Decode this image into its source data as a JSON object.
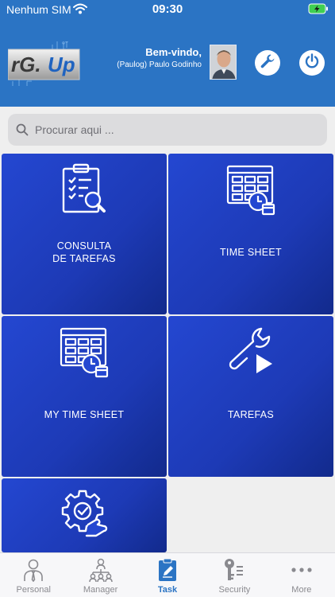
{
  "status_bar": {
    "carrier": "Nenhum SIM",
    "time": "09:30"
  },
  "header": {
    "welcome_title": "Bem-vindo,",
    "welcome_user": "(Paulog) Paulo Godinho",
    "brand_color": "#2b74c4"
  },
  "search": {
    "placeholder": "Procurar aqui ..."
  },
  "tiles": [
    {
      "label_line1": "CONSULTA",
      "label_line2": "DE TAREFAS",
      "icon": "clipboard-search-icon"
    },
    {
      "label_line1": "TIME SHEET",
      "icon": "calendar-grid-clock-icon"
    },
    {
      "label_line1": "MY TIME SHEET",
      "icon": "calendar-grid-clock-icon"
    },
    {
      "label_line1": "TAREFAS",
      "icon": "wrench-play-icon"
    },
    {
      "label_line1": "",
      "icon": "gear-check-hand-icon"
    }
  ],
  "tabbar": {
    "items": [
      {
        "label": "Personal",
        "icon": "person-tie-icon"
      },
      {
        "label": "Manager",
        "icon": "org-chart-icon"
      },
      {
        "label": "Task",
        "icon": "task-edit-icon",
        "active": true
      },
      {
        "label": "Security",
        "icon": "keys-icon"
      },
      {
        "label": "More",
        "icon": "ellipsis-icon"
      }
    ],
    "active_color": "#2b74c4"
  }
}
